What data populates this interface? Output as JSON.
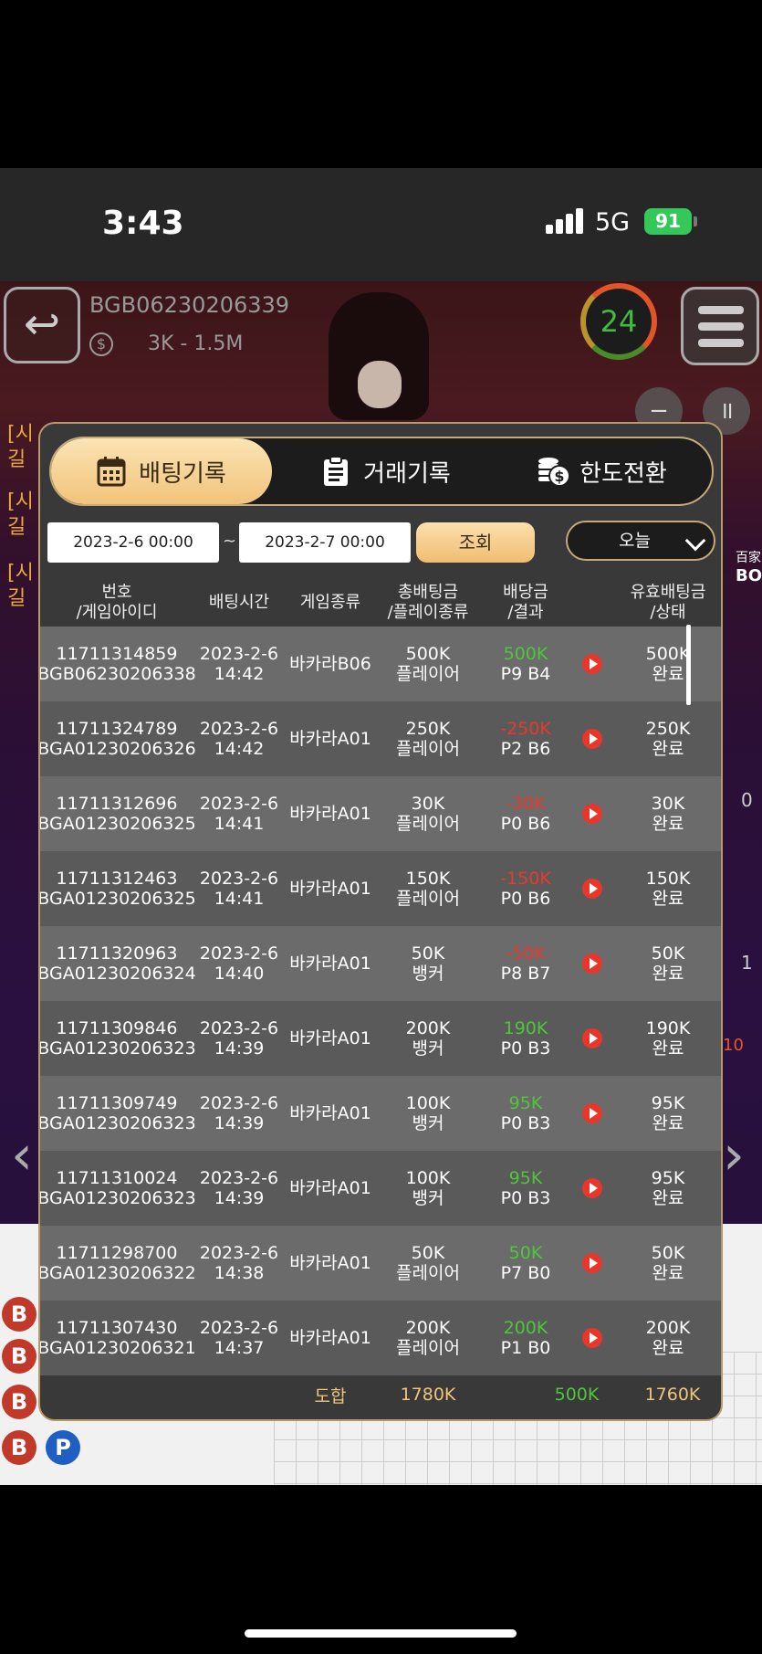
{
  "status": {
    "time": "3:43",
    "network": "5G",
    "battery": "91"
  },
  "game": {
    "table_id": "BGB06230206339",
    "limits": "3K - 1.5M",
    "timer": "24",
    "chat": [
      "[시",
      "길",
      "[시",
      "길",
      "[시",
      "길"
    ],
    "right_counts": [
      "0",
      "1"
    ],
    "right_badge": "10",
    "side_labels": [
      "百家",
      "BO"
    ],
    "road": [
      "B",
      "B",
      "B",
      "B",
      "P"
    ]
  },
  "tabs": [
    {
      "label": "배팅기록",
      "icon": "calendar-icon",
      "active": true
    },
    {
      "label": "거래기록",
      "icon": "clipboard-icon",
      "active": false
    },
    {
      "label": "한도전환",
      "icon": "coins-dollar-icon",
      "active": false
    }
  ],
  "filters": {
    "date_from": "2023-2-6 00:00",
    "separator": "~",
    "date_to": "2023-2-7 00:00",
    "query_label": "조회",
    "period": "오늘"
  },
  "table": {
    "headers": [
      "번호\n/게임아이디",
      "배팅시간",
      "게임종류",
      "총배팅금\n/플레이종류",
      "배당금\n/결과",
      "유효배팅금\n/상태"
    ],
    "rows": [
      {
        "no": "11711314859",
        "game_id": "BGB06230206338",
        "date": "2023-2-6",
        "time": "14:42",
        "game": "바카라B06",
        "bet": "500K",
        "play": "플레이어",
        "payout": "500K",
        "result": "P9 B4",
        "win": true,
        "valid": "500K",
        "status": "완료"
      },
      {
        "no": "11711324789",
        "game_id": "BGA01230206326",
        "date": "2023-2-6",
        "time": "14:42",
        "game": "바카라A01",
        "bet": "250K",
        "play": "플레이어",
        "payout": "-250K",
        "result": "P2 B6",
        "win": false,
        "valid": "250K",
        "status": "완료"
      },
      {
        "no": "11711312696",
        "game_id": "BGA01230206325",
        "date": "2023-2-6",
        "time": "14:41",
        "game": "바카라A01",
        "bet": "30K",
        "play": "플레이어",
        "payout": "-30K",
        "result": "P0 B6",
        "win": false,
        "valid": "30K",
        "status": "완료"
      },
      {
        "no": "11711312463",
        "game_id": "BGA01230206325",
        "date": "2023-2-6",
        "time": "14:41",
        "game": "바카라A01",
        "bet": "150K",
        "play": "플레이어",
        "payout": "-150K",
        "result": "P0 B6",
        "win": false,
        "valid": "150K",
        "status": "완료"
      },
      {
        "no": "11711320963",
        "game_id": "BGA01230206324",
        "date": "2023-2-6",
        "time": "14:40",
        "game": "바카라A01",
        "bet": "50K",
        "play": "뱅커",
        "payout": "-50K",
        "result": "P8 B7",
        "win": false,
        "valid": "50K",
        "status": "완료"
      },
      {
        "no": "11711309846",
        "game_id": "BGA01230206323",
        "date": "2023-2-6",
        "time": "14:39",
        "game": "바카라A01",
        "bet": "200K",
        "play": "뱅커",
        "payout": "190K",
        "result": "P0 B3",
        "win": true,
        "valid": "190K",
        "status": "완료"
      },
      {
        "no": "11711309749",
        "game_id": "BGA01230206323",
        "date": "2023-2-6",
        "time": "14:39",
        "game": "바카라A01",
        "bet": "100K",
        "play": "뱅커",
        "payout": "95K",
        "result": "P0 B3",
        "win": true,
        "valid": "95K",
        "status": "완료"
      },
      {
        "no": "11711310024",
        "game_id": "BGA01230206323",
        "date": "2023-2-6",
        "time": "14:39",
        "game": "바카라A01",
        "bet": "100K",
        "play": "뱅커",
        "payout": "95K",
        "result": "P0 B3",
        "win": true,
        "valid": "95K",
        "status": "완료"
      },
      {
        "no": "11711298700",
        "game_id": "BGA01230206322",
        "date": "2023-2-6",
        "time": "14:38",
        "game": "바카라A01",
        "bet": "50K",
        "play": "플레이어",
        "payout": "50K",
        "result": "P7 B0",
        "win": true,
        "valid": "50K",
        "status": "완료"
      },
      {
        "no": "11711307430",
        "game_id": "BGA01230206321",
        "date": "2023-2-6",
        "time": "14:37",
        "game": "바카라A01",
        "bet": "200K",
        "play": "플레이어",
        "payout": "200K",
        "result": "P1 B0",
        "win": true,
        "valid": "200K",
        "status": "완료"
      }
    ],
    "totals": {
      "label": "도합",
      "bet": "1780K",
      "payout": "500K",
      "valid": "1760K"
    }
  },
  "colors": {
    "win": "#4fc63a",
    "loss": "#e53b2c",
    "gold": "#c6a978",
    "play": "#e8372a"
  }
}
